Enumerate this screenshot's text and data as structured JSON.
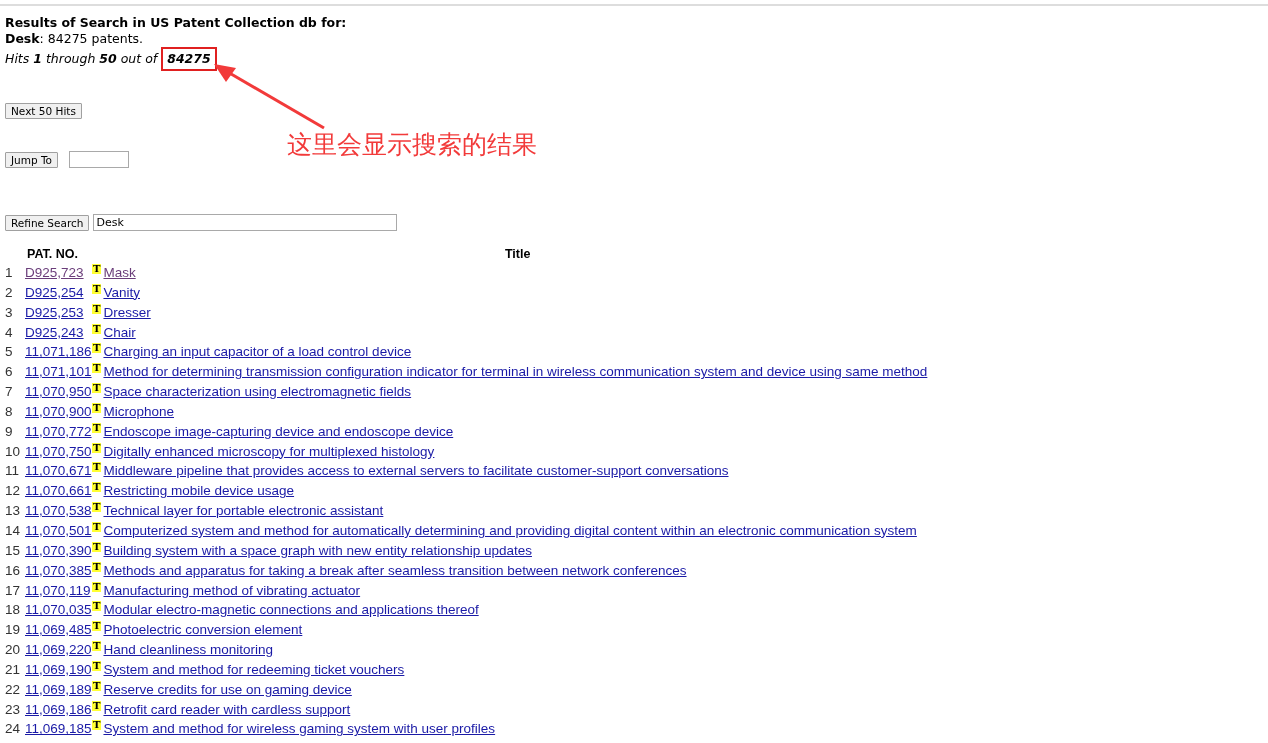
{
  "header": {
    "title": "Results of Search in US Patent Collection db for:",
    "query_term": "Desk",
    "query_summary": ": 84275 patents.",
    "hits_line": "Hits **1** through **50** out of",
    "hits_total": "84275"
  },
  "annotation": {
    "note": "这里会显示搜索的结果"
  },
  "controls": {
    "next_button": "Next 50 Hits",
    "jump_button": "Jump To",
    "refine_button": "Refine Search",
    "refine_value": "Desk"
  },
  "table": {
    "columns": [
      "PAT. NO.",
      "Title"
    ],
    "rows": [
      {
        "index": "1",
        "number": "D925,723",
        "badge": "T",
        "title": "Mask",
        "visited": true
      },
      {
        "index": "2",
        "number": "D925,254",
        "badge": "T",
        "title": "Vanity",
        "visited": false
      },
      {
        "index": "3",
        "number": "D925,253",
        "badge": "T",
        "title": "Dresser",
        "visited": false
      },
      {
        "index": "4",
        "number": "D925,243",
        "badge": "T",
        "title": "Chair",
        "visited": false
      },
      {
        "index": "5",
        "number": "11,071,186",
        "badge": "T",
        "title": "Charging an input capacitor of a load control device",
        "visited": false
      },
      {
        "index": "6",
        "number": "11,071,101",
        "badge": "T",
        "title": "Method for determining transmission configuration indicator for terminal in wireless communication system and device using same method",
        "visited": false
      },
      {
        "index": "7",
        "number": "11,070,950",
        "badge": "T",
        "title": "Space characterization using electromagnetic fields",
        "visited": false
      },
      {
        "index": "8",
        "number": "11,070,900",
        "badge": "T",
        "title": "Microphone",
        "visited": false
      },
      {
        "index": "9",
        "number": "11,070,772",
        "badge": "T",
        "title": "Endoscope image-capturing device and endoscope device",
        "visited": false
      },
      {
        "index": "10",
        "number": "11,070,750",
        "badge": "T",
        "title": "Digitally enhanced microscopy for multiplexed histology",
        "visited": false
      },
      {
        "index": "11",
        "number": "11,070,671",
        "badge": "T",
        "title": "Middleware pipeline that provides access to external servers to facilitate customer-support conversations",
        "visited": false
      },
      {
        "index": "12",
        "number": "11,070,661",
        "badge": "T",
        "title": "Restricting mobile device usage",
        "visited": false
      },
      {
        "index": "13",
        "number": "11,070,538",
        "badge": "T",
        "title": "Technical layer for portable electronic assistant",
        "visited": false
      },
      {
        "index": "14",
        "number": "11,070,501",
        "badge": "T",
        "title": "Computerized system and method for automatically determining and providing digital content within an electronic communication system",
        "visited": false
      },
      {
        "index": "15",
        "number": "11,070,390",
        "badge": "T",
        "title": "Building system with a space graph with new entity relationship updates",
        "visited": false
      },
      {
        "index": "16",
        "number": "11,070,385",
        "badge": "T",
        "title": "Methods and apparatus for taking a break after seamless transition between network conferences",
        "visited": false
      },
      {
        "index": "17",
        "number": "11,070,119",
        "badge": "T",
        "title": "Manufacturing method of vibrating actuator",
        "visited": false
      },
      {
        "index": "18",
        "number": "11,070,035",
        "badge": "T",
        "title": "Modular electro-magnetic connections and applications thereof",
        "visited": false
      },
      {
        "index": "19",
        "number": "11,069,485",
        "badge": "T",
        "title": "Photoelectric conversion element",
        "visited": false
      },
      {
        "index": "20",
        "number": "11,069,220",
        "badge": "T",
        "title": "Hand cleanliness monitoring",
        "visited": false
      },
      {
        "index": "21",
        "number": "11,069,190",
        "badge": "T",
        "title": "System and method for redeeming ticket vouchers",
        "visited": false
      },
      {
        "index": "22",
        "number": "11,069,189",
        "badge": "T",
        "title": "Reserve credits for use on gaming device",
        "visited": false
      },
      {
        "index": "23",
        "number": "11,069,186",
        "badge": "T",
        "title": "Retrofit card reader with cardless support",
        "visited": false
      },
      {
        "index": "24",
        "number": "11,069,185",
        "badge": "T",
        "title": "System and method for wireless gaming system with user profiles",
        "visited": false
      }
    ]
  }
}
